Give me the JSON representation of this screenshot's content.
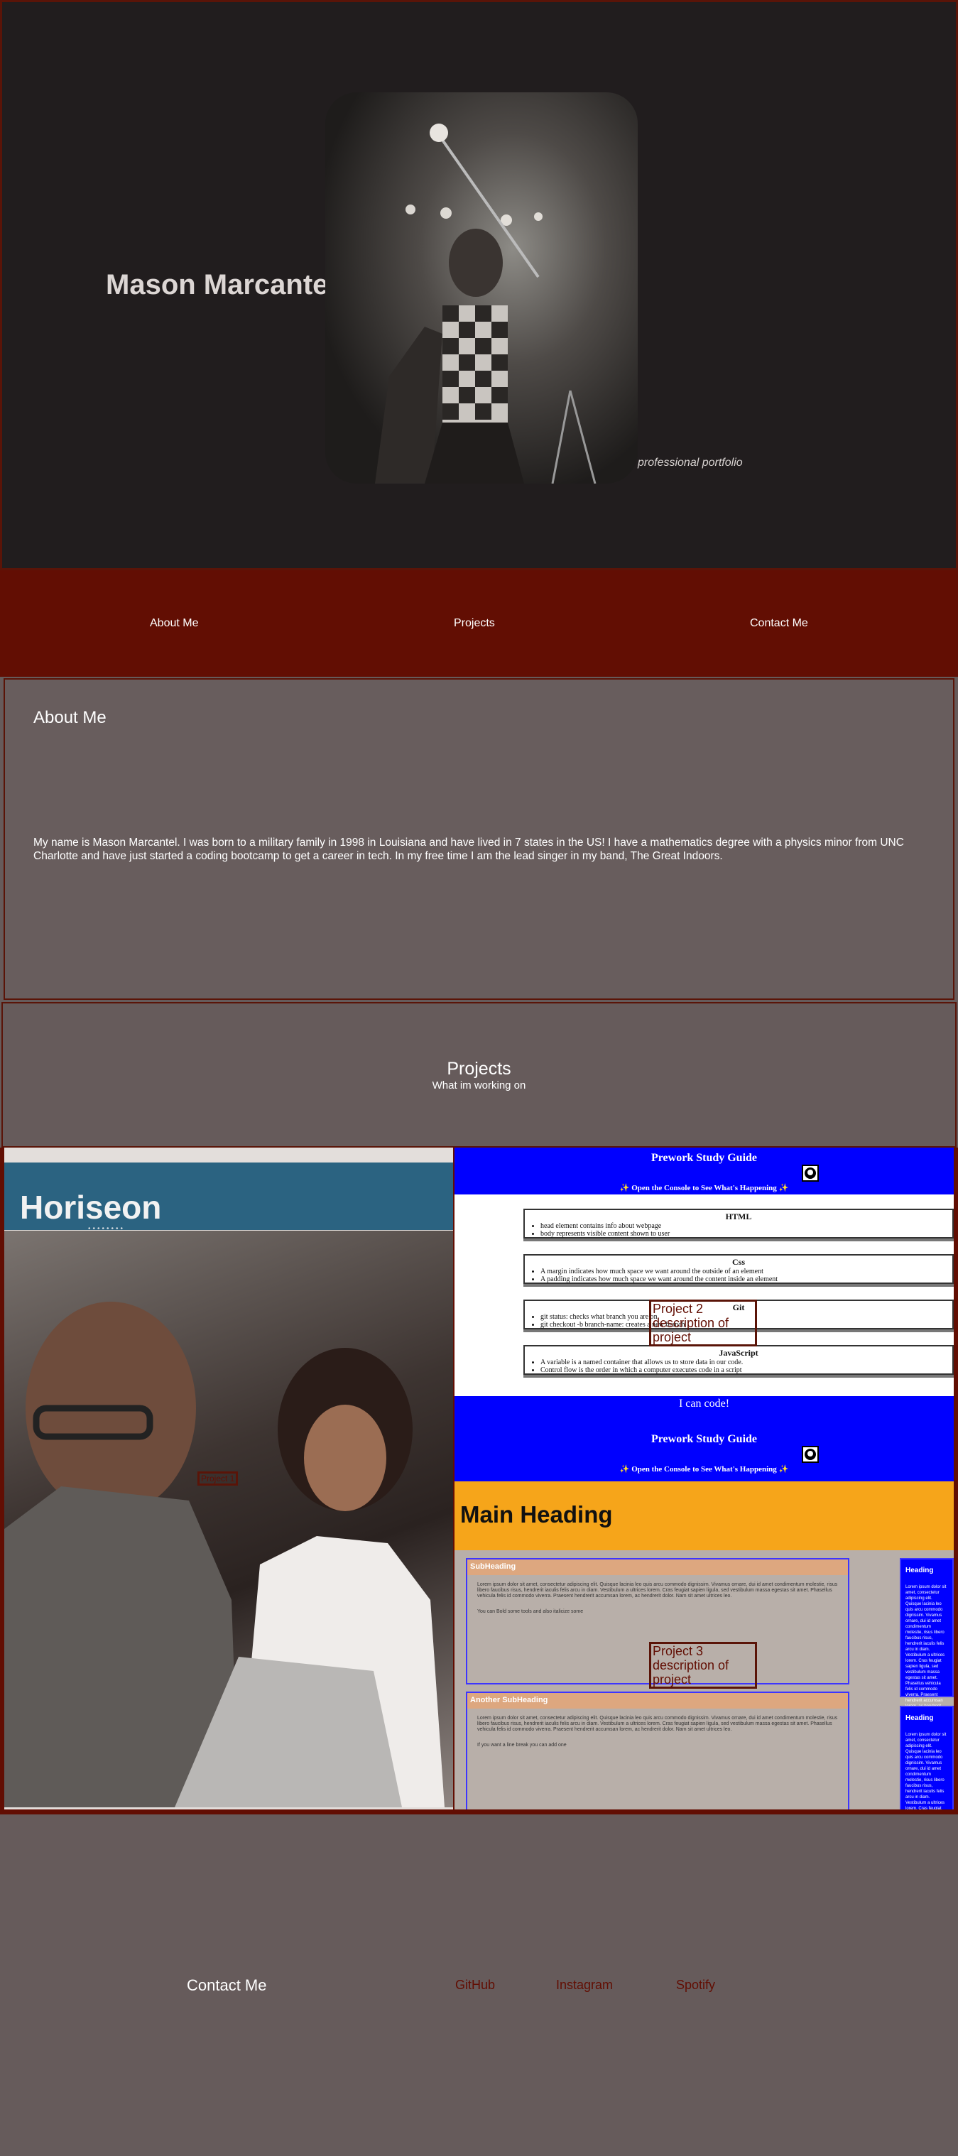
{
  "hero": {
    "name": "Mason Marcantel",
    "tagline": "professional portfolio"
  },
  "nav": {
    "items": [
      "About Me",
      "Projects",
      "Contact Me"
    ]
  },
  "about": {
    "heading": "About Me",
    "body": "My name is Mason Marcantel. I was born to a military family in 1998 in Louisiana and have lived in 7 states in the US! I have a mathematics degree with a physics minor from UNC Charlotte and have just started a coding bootcamp to get a career in tech. In my free time I am the lead singer in my band, The Great Indoors."
  },
  "projects": {
    "heading": "Projects",
    "subheading": "What im working on",
    "project1": {
      "logo": "Horiseon",
      "overlay": "Project 1"
    },
    "project2": {
      "guide_title": "Prework Study Guide",
      "console_note": "✨ Open the Console to See What's Happening ✨",
      "topics": [
        {
          "title": "HTML",
          "items": [
            "head element contains info about webpage",
            "body represents visible content shown to user"
          ]
        },
        {
          "title": "Css",
          "items": [
            "A margin indicates how much space we want around the outside of an element",
            "A padding indicates how much space we want around the content inside an element"
          ]
        },
        {
          "title": "Git",
          "items": [
            "git status: checks what branch you are on",
            "git checkout -b branch-name: creates a new branch"
          ]
        },
        {
          "title": "JavaScript",
          "items": [
            "A variable is a named container that allows us to store data in our code.",
            "Control flow is the order in which a computer executes code in a script"
          ]
        }
      ],
      "footer": "I can code!",
      "overlay_title": "Project 2",
      "overlay_desc": "description of project"
    },
    "project3": {
      "main_heading": "Main Heading",
      "sub1": "SubHeading",
      "sub2": "Another SubHeading",
      "side": "Heading",
      "lorem": "Lorem ipsum dolor sit amet, consectetur adipiscing elit. Quisque lacinia leo quis arcu commodo dignissim. Vivamus ornare, dui id amet condimentum molestie, risus libero faucibus risus, hendrerit iaculis felis arcu in diam. Vestibulum a ultrices lorem. Cras feugiat sapien ligula, sed vestibulum massa egestas sit amet. Phasellus vehicula felis id commodo viverra. Praesent hendrerit accumsan lorem, ac hendrerit dolor. Nam sit amet ultrices leo.",
      "note1": "You can Bold some tools and also italicize some",
      "note2": "If you want a line break you can add one",
      "overlay_title": "Project 3",
      "overlay_desc": "description of project"
    }
  },
  "contact": {
    "heading": "Contact Me",
    "links": [
      "GitHub",
      "Instagram",
      "Spotify"
    ]
  },
  "colors": {
    "nav_bg": "#620e03",
    "hero_bg": "#211d1e",
    "section_bg": "#665b5b",
    "study_blue": "#0000ff",
    "main_heading_orange": "#f6a51a"
  }
}
